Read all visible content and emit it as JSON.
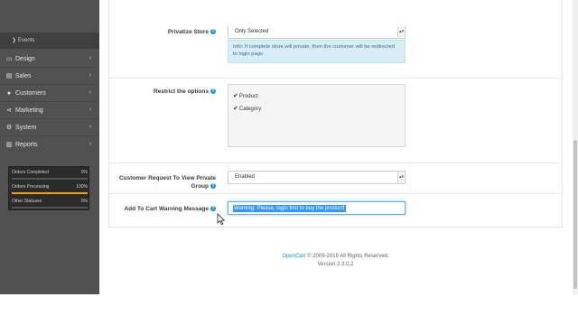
{
  "sidebar": {
    "sub_item": {
      "label": "Events"
    },
    "items": [
      {
        "label": "Design",
        "icon": "monitor-icon"
      },
      {
        "label": "Sales",
        "icon": "cart-icon"
      },
      {
        "label": "Customers",
        "icon": "user-icon"
      },
      {
        "label": "Marketing",
        "icon": "share-icon"
      },
      {
        "label": "System",
        "icon": "gear-icon"
      },
      {
        "label": "Reports",
        "icon": "bar-chart-icon"
      }
    ],
    "stats": [
      {
        "label": "Orders Completed",
        "value": "0%",
        "percent": 0,
        "color": "#777777"
      },
      {
        "label": "Orders Processing",
        "value": "100%",
        "percent": 100,
        "color": "#f0a30a"
      },
      {
        "label": "Other Statuses",
        "value": "0%",
        "percent": 0,
        "color": "#777777"
      }
    ]
  },
  "form": {
    "privatize_store": {
      "label": "Privatize Store",
      "selected": "Only Selected",
      "info": "Info: If complete store will private, then the customer will be redirected to login page."
    },
    "restrict_options": {
      "label": "Restrict the options",
      "options": [
        {
          "label": "Product",
          "checked": true
        },
        {
          "label": "Category",
          "checked": true
        }
      ]
    },
    "customer_request": {
      "label_line1": "Customer Request To View Private",
      "label_line2": "Group",
      "selected": "Enabled"
    },
    "warning_message": {
      "label": "Add To Cart Warning Message",
      "value": "Warning: Please,  login first to buy the product!"
    }
  },
  "footer": {
    "link": "OpenCart",
    "copyright": "© 2009-2019 All Rights Reserved.",
    "version": "Version 2.3.0.2"
  },
  "colors": {
    "sidebar_bg": "#515151",
    "accent": "#1e91cf",
    "info_bg": "#d9edf7",
    "selection": "#3399ff"
  }
}
